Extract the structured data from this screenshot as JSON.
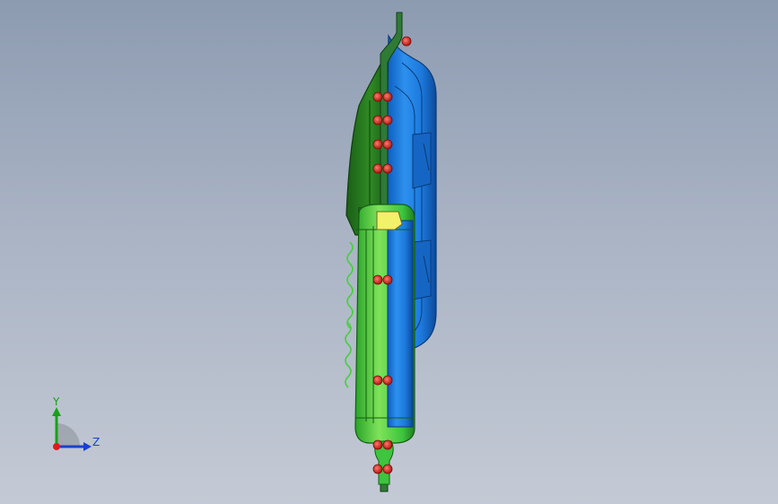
{
  "viewport": {
    "background_top": "#8d9bb1",
    "background_bottom": "#c4cad5"
  },
  "model": {
    "colors": {
      "blue_body": "#1e7fe0",
      "blue_dark": "#0d4fa0",
      "green_body": "#3ec43e",
      "green_dark": "#1f6b1a",
      "yellow_part": "#f3f06a",
      "red_marker": "#e0261f",
      "plate_edge": "#2a5e2a"
    }
  },
  "triad": {
    "y_label": "Y",
    "z_label": "Z",
    "y_color": "#1aa01a",
    "z_color": "#1a3fd0",
    "x_color": "#e01a1a"
  }
}
